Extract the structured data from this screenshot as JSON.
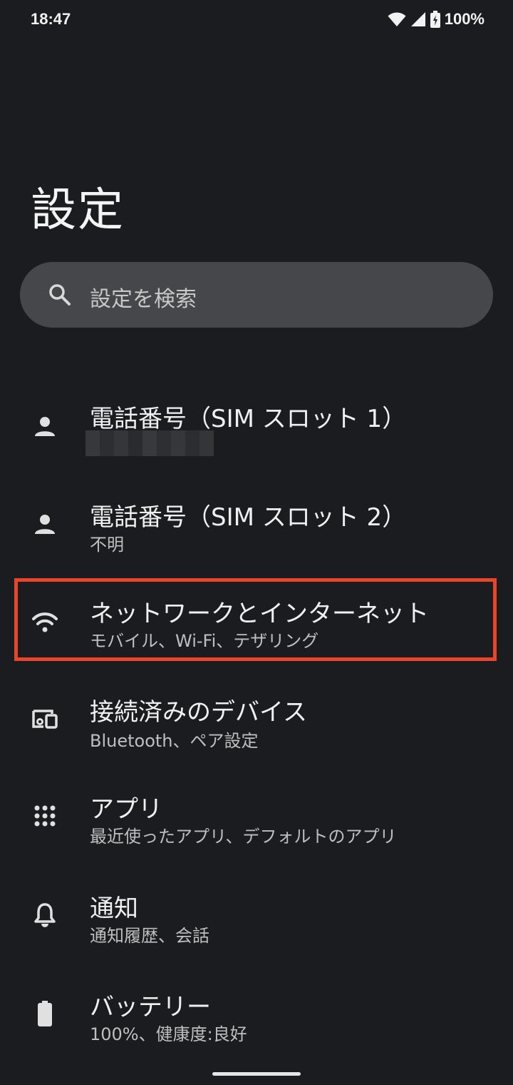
{
  "status_bar": {
    "time": "18:47",
    "battery": "100%",
    "icons": [
      "wifi-icon",
      "cellular-signal-icon",
      "battery-charging-icon"
    ]
  },
  "page_title": "設定",
  "search": {
    "placeholder": "設定を検索"
  },
  "items": [
    {
      "title": "電話番号（SIM スロット 1）",
      "subtitle": "",
      "icon": "person-icon",
      "masked": true
    },
    {
      "title": "電話番号（SIM スロット 2）",
      "subtitle": "不明",
      "icon": "person-icon"
    },
    {
      "title": "ネットワークとインターネット",
      "subtitle": "モバイル、Wi-Fi、テザリング",
      "icon": "wifi-icon",
      "highlighted": true
    },
    {
      "title": "接続済みのデバイス",
      "subtitle": "Bluetooth、ペア設定",
      "icon": "connected-devices-icon"
    },
    {
      "title": "アプリ",
      "subtitle": "最近使ったアプリ、デフォルトのアプリ",
      "icon": "apps-grid-icon"
    },
    {
      "title": "通知",
      "subtitle": "通知履歴、会話",
      "icon": "bell-icon"
    },
    {
      "title": "バッテリー",
      "subtitle": "100%、健康度:良好",
      "icon": "battery-icon"
    }
  ],
  "colors": {
    "background": "#1b1c1f",
    "search_bg": "#45474b",
    "highlight": "#e8452a"
  }
}
